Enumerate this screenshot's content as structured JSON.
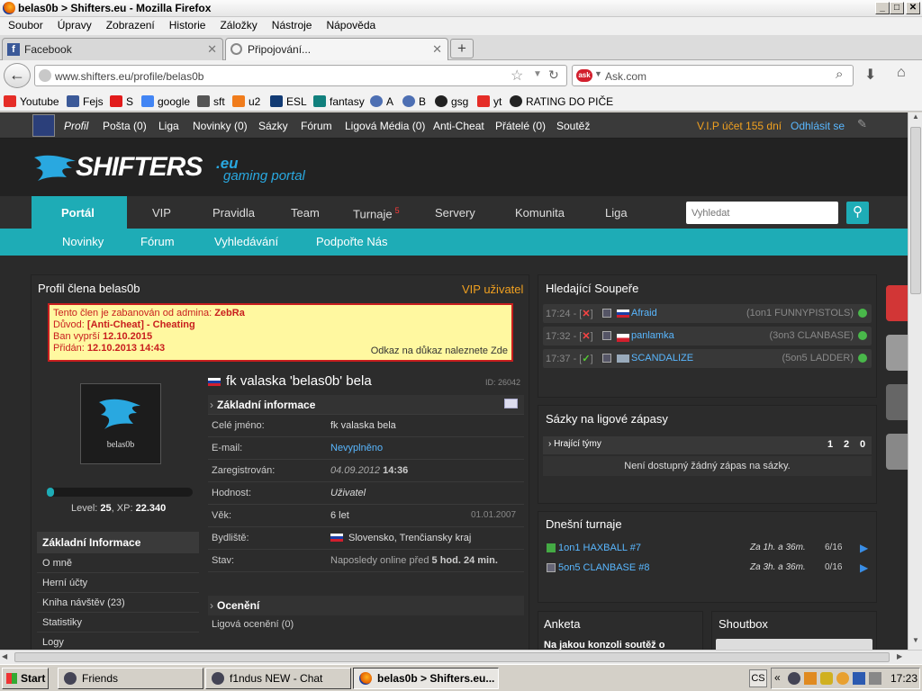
{
  "window": {
    "title": "belas0b > Shifters.eu - Mozilla Firefox"
  },
  "menu": [
    "Soubor",
    "Úpravy",
    "Zobrazení",
    "Historie",
    "Záložky",
    "Nástroje",
    "Nápověda"
  ],
  "tabs": [
    {
      "label": "Facebook"
    },
    {
      "label": "Připojování..."
    }
  ],
  "nav": {
    "url": "www.shifters.eu/profile/belas0b",
    "search_placeholder": "Ask.com"
  },
  "bookmarks": [
    {
      "label": "Youtube",
      "color": "#e52d27"
    },
    {
      "label": "Fejs",
      "color": "#3b5998"
    },
    {
      "label": "S",
      "color": "#e21b1b"
    },
    {
      "label": "google",
      "color": "#4285f4"
    },
    {
      "label": "sft",
      "color": "#555"
    },
    {
      "label": "u2",
      "color": "#f07c1c"
    },
    {
      "label": "ESL",
      "color": "#123b74"
    },
    {
      "label": "fantasy",
      "color": "#11807d"
    },
    {
      "label": "A",
      "color": "#4d6fb3"
    },
    {
      "label": "B",
      "color": "#4d6fb3"
    },
    {
      "label": "gsg",
      "color": "#222"
    },
    {
      "label": "yt",
      "color": "#e52d27"
    },
    {
      "label": "RATING DO PIČE",
      "color": "#222"
    }
  ],
  "site": {
    "topbar": {
      "profile": "Profil",
      "items": [
        "Pošta (0)",
        "Liga",
        "Novinky (0)",
        "Sázky",
        "Fórum",
        "Ligová Média (0)",
        "Anti-Cheat",
        "Přátelé (0)",
        "Soutěž"
      ],
      "vip": "V.I.P účet 155 dní",
      "logout": "Odhlásit se"
    },
    "logo": {
      "main": "SHIFTERS",
      "eu": ".eu",
      "sub": "gaming portal"
    },
    "mainnav": [
      {
        "label": "Portál"
      },
      {
        "label": "VIP"
      },
      {
        "label": "Pravidla"
      },
      {
        "label": "Team"
      },
      {
        "label": "Turnaje",
        "badge": "5"
      },
      {
        "label": "Servery"
      },
      {
        "label": "Komunita"
      },
      {
        "label": "Liga"
      }
    ],
    "search_placeholder": "Vyhledat",
    "subnav": [
      "Novinky",
      "Fórum",
      "Vyhledávání",
      "Podpořte Nás"
    ]
  },
  "profile": {
    "header": "Profil člena belas0b",
    "vip": "VIP uživatel",
    "ban": {
      "line1_label": "Tento člen je zabanován od admina:",
      "admin": "ZebRa",
      "line2_label": "Důvod:",
      "reason_tag": "[Anti-Cheat]",
      "reason": "- Cheating",
      "line3_label": "Ban vyprší",
      "expires": "12.10.2015",
      "line4_label": "Přidán:",
      "added": "12.10.2013 14:43",
      "proof": "Odkaz na důkaz naleznete Zde"
    },
    "avatar_name": "belas0b",
    "level_text": "Level:",
    "level": "25",
    "xp_text": "XP:",
    "xp": "22.340",
    "level_progress": 0.05,
    "sidebar": [
      "Základní Informace",
      "O mně",
      "Herní účty",
      "Kniha návštěv (23)",
      "Statistiky",
      "Logy"
    ],
    "name": "fk valaska 'belas0b' bela",
    "id": "ID: 26042",
    "basic_title": "Základní informace",
    "fields": [
      {
        "label": "Celé jméno:",
        "value": "fk valaska  bela"
      },
      {
        "label": "E-mail:",
        "value": "Nevyplněno"
      },
      {
        "label": "Zaregistrován:",
        "value": "04.09.2012",
        "extra": "14:36"
      },
      {
        "label": "Hodnost:",
        "value": "Uživatel"
      },
      {
        "label": "Věk:",
        "value": "6 let",
        "extra": "01.01.2007"
      },
      {
        "label": "Bydliště:",
        "value": "Slovensko, Trenčiansky kraj"
      },
      {
        "label": "Stav:",
        "value": "Naposledy online před",
        "extra": "5 hod. 24 min."
      }
    ],
    "awards_title": "Ocenění",
    "awards_row": "Ligová ocenění (0)"
  },
  "opponents": {
    "title": "Hledající Soupeře",
    "rows": [
      {
        "time": "17:24 - [",
        "mark": "✕",
        "name": "Afraid",
        "info": "(1on1 FUNNYPISTOLS)"
      },
      {
        "time": "17:32 - [",
        "mark": "✕",
        "name": "panlamka",
        "info": "(3on3 CLANBASE)"
      },
      {
        "time": "17:37 - [",
        "mark": "✓",
        "name": "SCANDALIZE",
        "info": "(5on5 LADDER)"
      }
    ]
  },
  "bets": {
    "title": "Sázky na ligové zápasy",
    "sub": "Hrající týmy",
    "cols": [
      "1",
      "2",
      "0"
    ],
    "empty": "Není dostupný žádný zápas na sázky."
  },
  "tournaments": {
    "title": "Dnešní turnaje",
    "rows": [
      {
        "name": "1on1 HAXBALL #7",
        "when": "Za 1h. a 36m.",
        "slots": "6/16"
      },
      {
        "name": "5on5 CLANBASE #8",
        "when": "Za 3h. a 36m.",
        "slots": "0/16"
      }
    ]
  },
  "poll": {
    "title": "Anketa",
    "question": "Na jakou konzoli soutěž o"
  },
  "shoutbox": {
    "title": "Shoutbox"
  },
  "taskbar": {
    "start": "Start",
    "tasks": [
      "Friends",
      "f1ndus NEW - Chat",
      "belas0b > Shifters.eu..."
    ],
    "lang": "CS",
    "clock": "17:23"
  }
}
